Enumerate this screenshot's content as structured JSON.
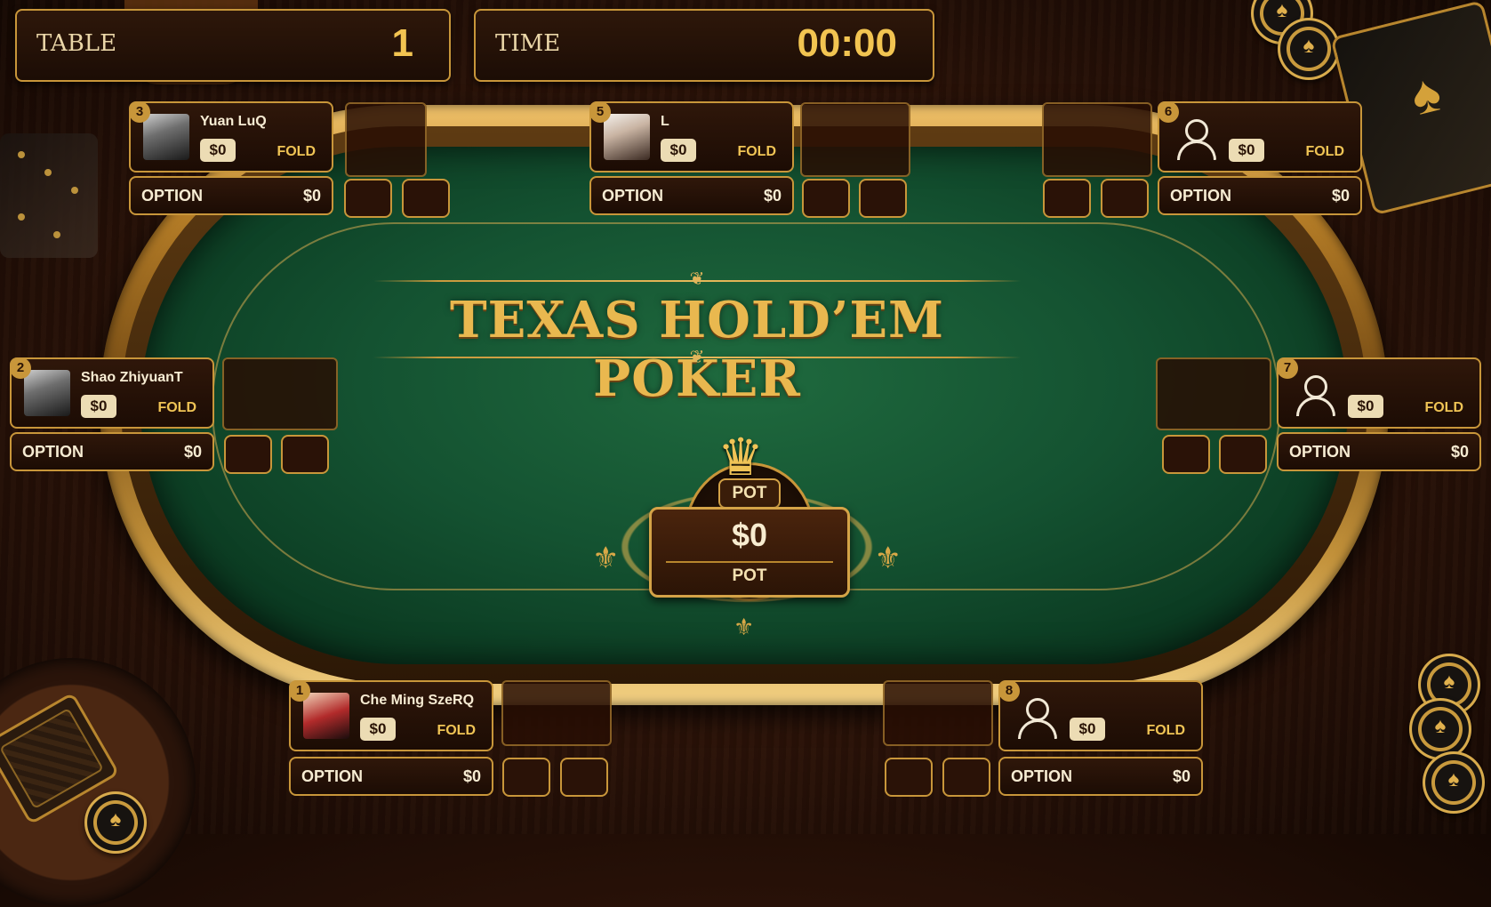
{
  "hud": {
    "table_label": "TABLE",
    "table_value": "1",
    "time_label": "TIME",
    "time_value": "00:00"
  },
  "title": "TEXAS HOLD’EM POKER",
  "pot": {
    "tag": "POT",
    "amount": "$0",
    "label": "POT"
  },
  "players": [
    {
      "seat": "1",
      "name": "Che Ming SzeRQ",
      "chips": "$0",
      "status": "FOLD",
      "option_label": "OPTION",
      "option_amount": "$0",
      "avatar": "photo-red"
    },
    {
      "seat": "2",
      "name": "Shao ZhiyuanT",
      "chips": "$0",
      "status": "FOLD",
      "option_label": "OPTION",
      "option_amount": "$0",
      "avatar": "photo-grey"
    },
    {
      "seat": "3",
      "name": "Yuan LuQ",
      "chips": "$0",
      "status": "FOLD",
      "option_label": "OPTION",
      "option_amount": "$0",
      "avatar": "photo-grey"
    },
    {
      "seat": "5",
      "name": "L",
      "chips": "$0",
      "status": "FOLD",
      "option_label": "OPTION",
      "option_amount": "$0",
      "avatar": "photo-lady"
    },
    {
      "seat": "6",
      "name": "",
      "chips": "$0",
      "status": "FOLD",
      "option_label": "OPTION",
      "option_amount": "$0",
      "avatar": "generic-user-icon"
    },
    {
      "seat": "7",
      "name": "",
      "chips": "$0",
      "status": "FOLD",
      "option_label": "OPTION",
      "option_amount": "$0",
      "avatar": "generic-user-icon"
    },
    {
      "seat": "8",
      "name": "",
      "chips": "$0",
      "status": "FOLD",
      "option_label": "OPTION",
      "option_amount": "$0",
      "avatar": "generic-user-icon"
    }
  ],
  "colors": {
    "gold": "#c8963a",
    "felt": "#145231",
    "wood": "#2a1208"
  }
}
